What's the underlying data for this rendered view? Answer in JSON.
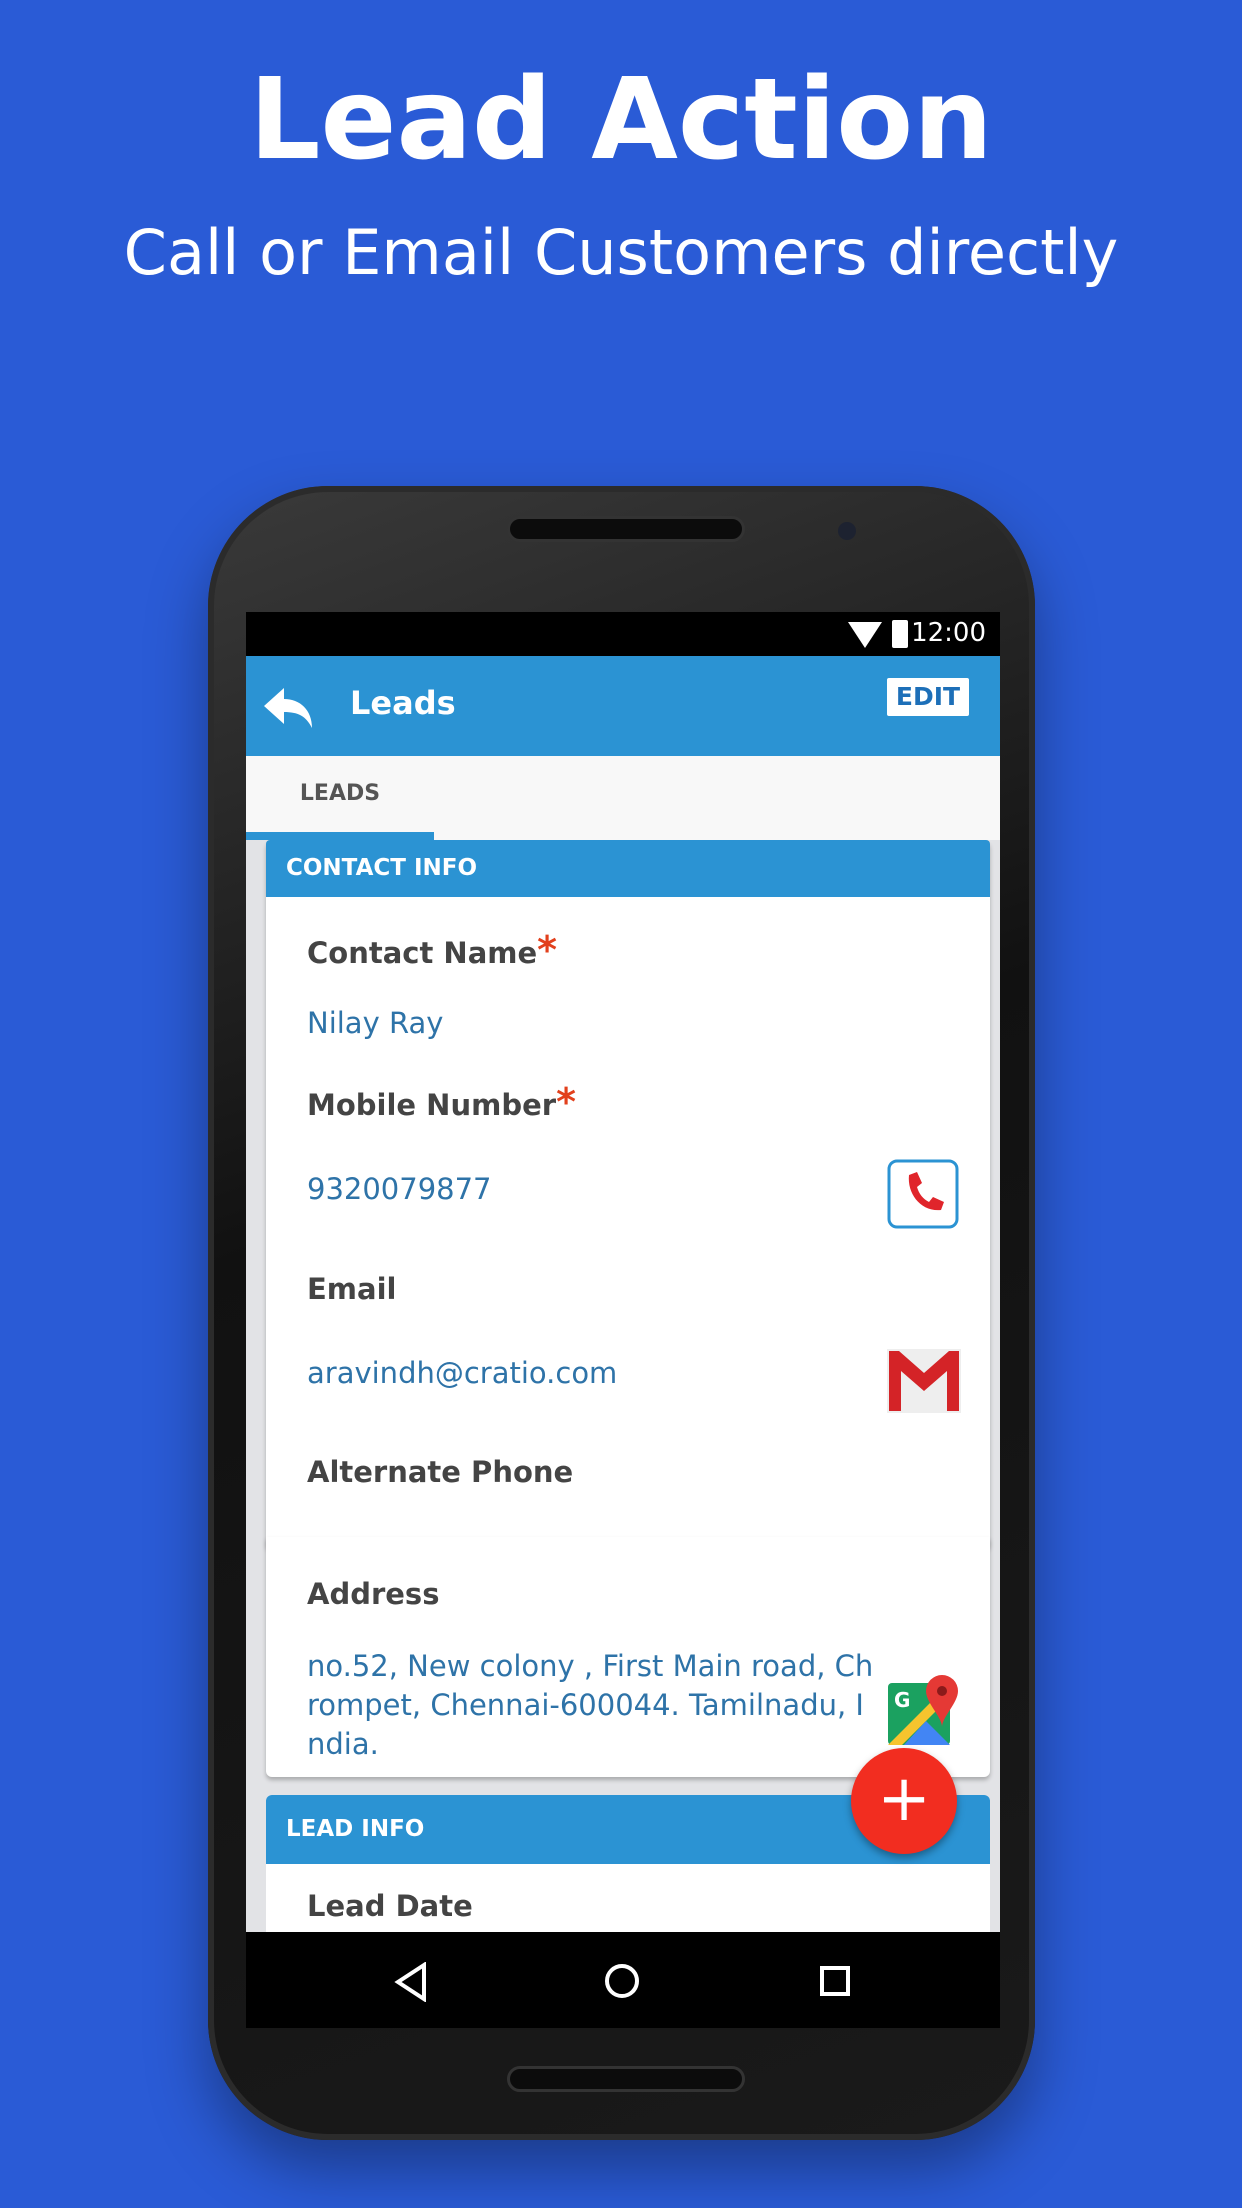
{
  "promo": {
    "title": "Lead Action",
    "subtitle": "Call or Email Customers directly"
  },
  "status_bar": {
    "time": "12:00"
  },
  "app_bar": {
    "title": "Leads",
    "edit_label": "EDIT"
  },
  "tabs": [
    {
      "label": "LEADS",
      "active": true
    }
  ],
  "contact_info": {
    "header": "CONTACT INFO",
    "fields": [
      {
        "label": "Contact Name",
        "required": "*",
        "value": "Nilay Ray"
      },
      {
        "label": "Mobile Number",
        "required": "*",
        "value": "9320079877",
        "action_icon": "phone-call-icon"
      },
      {
        "label": "Email",
        "value": "aravindh@cratio.com",
        "action_icon": "gmail-icon"
      },
      {
        "label": "Alternate Phone",
        "value": ""
      },
      {
        "label": "Address",
        "value_lines": [
          "no.52, New colony , First Main road, Ch",
          "rompet, Chennai-600044. Tamilnadu, I",
          "ndia."
        ],
        "action_icon": "google-maps-icon"
      }
    ]
  },
  "lead_info": {
    "header": "LEAD INFO",
    "fields": [
      {
        "label": "Lead Date"
      }
    ]
  },
  "fab": {
    "label": "+"
  },
  "colors": {
    "background": "#2a5bd6",
    "primary": "#2b93d3",
    "fab": "#f22d20",
    "value_text": "#2e73a8"
  }
}
